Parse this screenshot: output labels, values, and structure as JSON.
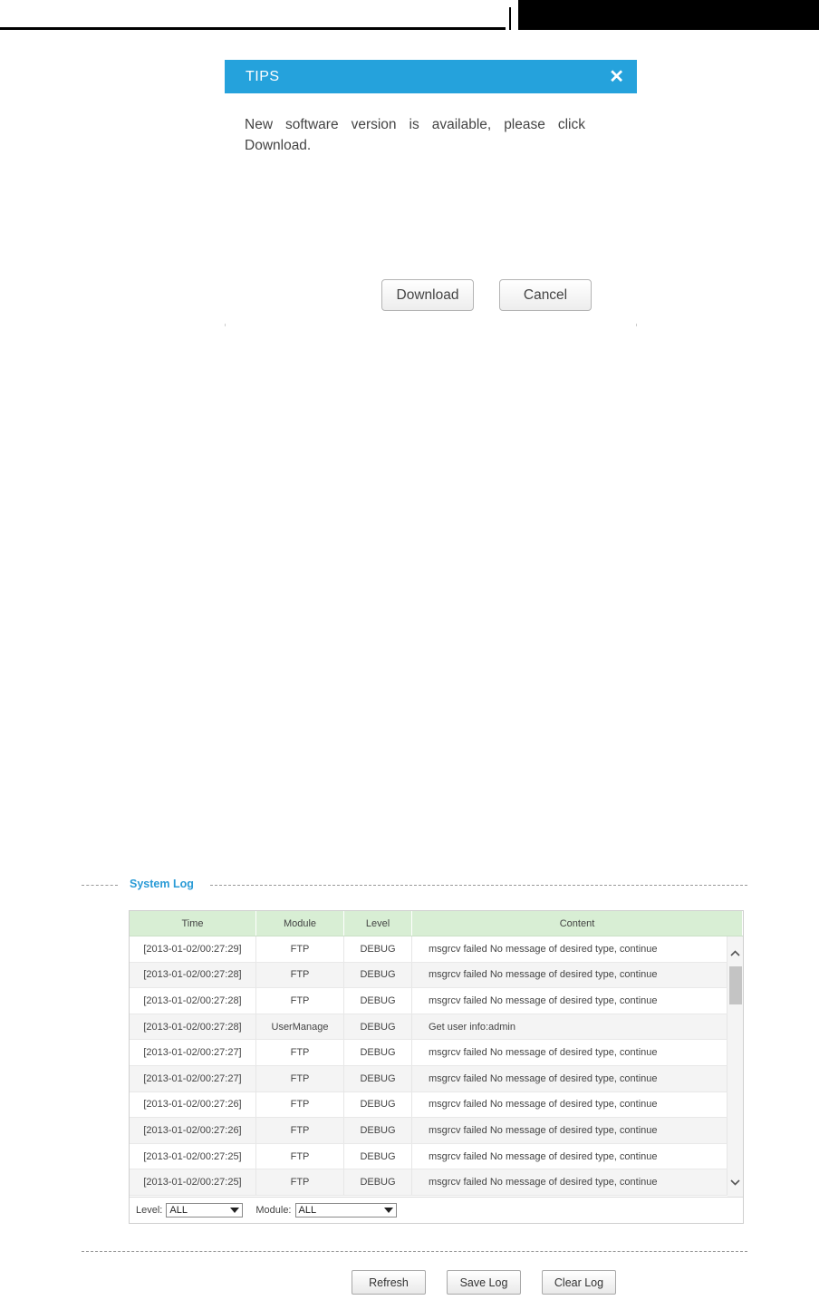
{
  "dialog": {
    "title": "TIPS",
    "close_glyph": "✕",
    "message": "New software version is available, please click Download.",
    "download_label": "Download",
    "cancel_label": "Cancel"
  },
  "system_log": {
    "title": "System Log",
    "columns": [
      "Time",
      "Module",
      "Level",
      "Content"
    ],
    "rows": [
      {
        "time": "[2013-01-02/00:27:29]",
        "module": "FTP",
        "level": "DEBUG",
        "content": "msgrcv failed No message of desired type, continue"
      },
      {
        "time": "[2013-01-02/00:27:28]",
        "module": "FTP",
        "level": "DEBUG",
        "content": "msgrcv failed No message of desired type, continue"
      },
      {
        "time": "[2013-01-02/00:27:28]",
        "module": "FTP",
        "level": "DEBUG",
        "content": "msgrcv failed No message of desired type, continue"
      },
      {
        "time": "[2013-01-02/00:27:28]",
        "module": "UserManage",
        "level": "DEBUG",
        "content": "Get user info:admin"
      },
      {
        "time": "[2013-01-02/00:27:27]",
        "module": "FTP",
        "level": "DEBUG",
        "content": "msgrcv failed No message of desired type, continue"
      },
      {
        "time": "[2013-01-02/00:27:27]",
        "module": "FTP",
        "level": "DEBUG",
        "content": "msgrcv failed No message of desired type, continue"
      },
      {
        "time": "[2013-01-02/00:27:26]",
        "module": "FTP",
        "level": "DEBUG",
        "content": "msgrcv failed No message of desired type, continue"
      },
      {
        "time": "[2013-01-02/00:27:26]",
        "module": "FTP",
        "level": "DEBUG",
        "content": "msgrcv failed No message of desired type, continue"
      },
      {
        "time": "[2013-01-02/00:27:25]",
        "module": "FTP",
        "level": "DEBUG",
        "content": "msgrcv failed No message of desired type, continue"
      },
      {
        "time": "[2013-01-02/00:27:25]",
        "module": "FTP",
        "level": "DEBUG",
        "content": "msgrcv failed No message of desired type, continue"
      }
    ],
    "filter": {
      "level_label": "Level:",
      "level_value": "ALL",
      "module_label": "Module:",
      "module_value": "ALL"
    },
    "buttons": {
      "refresh": "Refresh",
      "save": "Save Log",
      "clear": "Clear Log"
    }
  },
  "colors": {
    "dialog_header": "#25a2dc",
    "section_title": "#2a9bd6",
    "table_header": "#d8eed4"
  }
}
